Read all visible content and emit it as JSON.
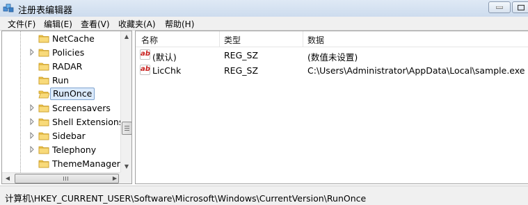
{
  "window": {
    "title": "注册表编辑器"
  },
  "menu": [
    "文件(F)",
    "编辑(E)",
    "查看(V)",
    "收藏夹(A)",
    "帮助(H)"
  ],
  "tree": {
    "items": [
      {
        "label": "NetCache",
        "expandable": false,
        "selected": false
      },
      {
        "label": "Policies",
        "expandable": true,
        "selected": false
      },
      {
        "label": "RADAR",
        "expandable": false,
        "selected": false
      },
      {
        "label": "Run",
        "expandable": false,
        "selected": false
      },
      {
        "label": "RunOnce",
        "expandable": false,
        "selected": true
      },
      {
        "label": "Screensavers",
        "expandable": true,
        "selected": false
      },
      {
        "label": "Shell Extensions",
        "expandable": true,
        "selected": false
      },
      {
        "label": "Sidebar",
        "expandable": true,
        "selected": false
      },
      {
        "label": "Telephony",
        "expandable": true,
        "selected": false
      },
      {
        "label": "ThemeManager",
        "expandable": false,
        "selected": false
      }
    ]
  },
  "list": {
    "columns": [
      "名称",
      "类型",
      "数据"
    ],
    "rows": [
      {
        "icon": "ab",
        "name": "(默认)",
        "type": "REG_SZ",
        "data": "(数值未设置)"
      },
      {
        "icon": "ab",
        "name": "LicChk",
        "type": "REG_SZ",
        "data": "C:\\Users\\Administrator\\AppData\\Local\\sample.exe"
      }
    ]
  },
  "status": {
    "path": "计算机\\HKEY_CURRENT_USER\\Software\\Microsoft\\Windows\\CurrentVersion\\RunOnce"
  },
  "icons": {
    "app": "registry-editor-icon",
    "folder": "folder-icon",
    "value": "string-value-icon"
  },
  "colors": {
    "selection": "#dcebfc",
    "selection_border": "#7da2ce",
    "folder": "#f2c94c",
    "value_icon": "#c8201e"
  }
}
